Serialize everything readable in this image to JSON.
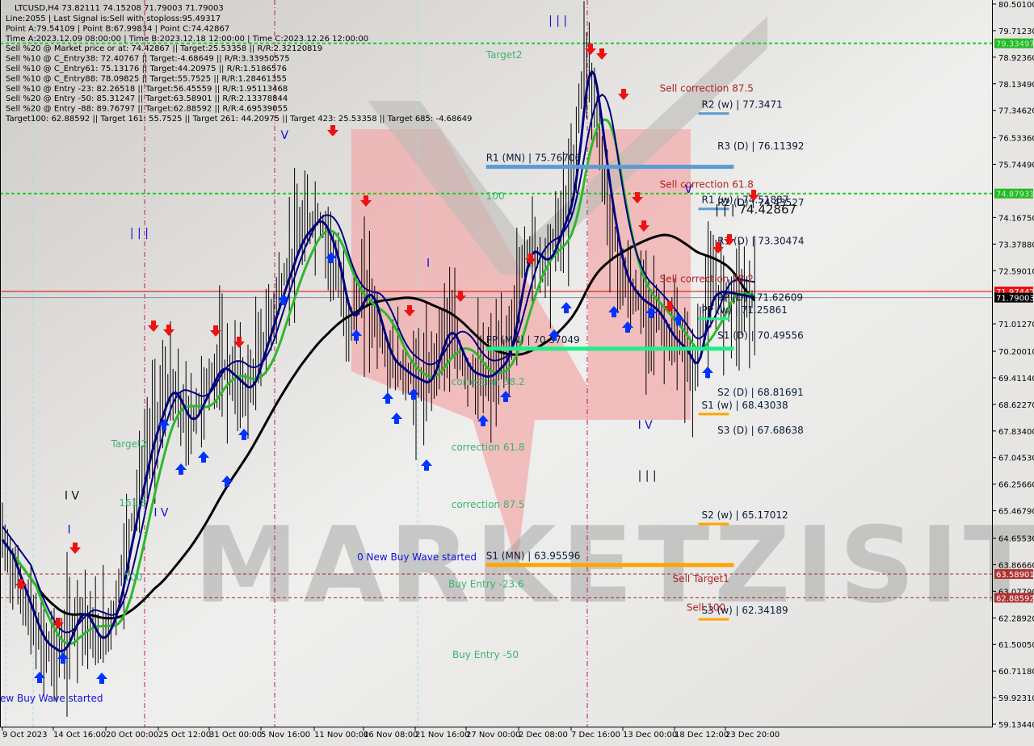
{
  "header": {
    "symbol_line": "LTCUSD,H4  73.82111 74.15208 71.79003 71.79003",
    "info_lines": [
      "Line:2055 | Last Signal is:Sell with stoploss:95.49317",
      "Point A:79.54109 | Point B:67.99834 | Point C:74.42867",
      "Time A:2023.12.09 08:00:00 | Time B:2023.12.18 12:00:00 | Time C:2023.12.26 12:00:00",
      "Sell %20 @ Market price or at: 74.42867 || Target:25.53358 || R/R:2.32120819",
      "Sell %10 @ C_Entry38: 72.40767 || Target:-4.68649 || R/R:3.33950575",
      "Sell %10 @ C_Entry61: 75.13176 || Target:44.20975 || R/R:1.5186576",
      "Sell %10 @ C_Entry88: 78.09825 || Target:55.7525 || R/R:1.28461355",
      "Sell %10 @ Entry -23: 82.26518 || Target:56.45559 || R/R:1.95113468",
      "Sell %20 @ Entry -50: 85.31247 || Target:63.58901 || R/R:2.13378844",
      "Sell %20 @ Entry -88: 89.76797 || Target:62.88592 || R/R:4.69539055",
      "Target100: 62.88592 || Target 161: 55.7525 || Target 261: 44.20975 || Target 423: 25.53358 || Target 685: -4.68649"
    ]
  },
  "colors": {
    "background": "#e6e5e3",
    "candle": "#000000",
    "ma_slow": "#000000",
    "ma_fast": "#000080",
    "ma_mid": "#2db82d",
    "green_level": "#22cc22",
    "red_level": "#a52a2a",
    "bid_line": "#dd0000",
    "pivot_blue": "#5b9bd5",
    "pivot_orange": "#ffa500",
    "pivot_green": "#22ee88",
    "watermark_pink": "#f0a0a0",
    "buy_arrow": "#0033ff",
    "sell_arrow": "#ee1111"
  },
  "chart_data": {
    "type": "candlestick",
    "title": "LTCUSD,H4",
    "ohlc_last": {
      "open": 73.82111,
      "high": 74.15208,
      "low": 71.79003,
      "close": 71.79003
    },
    "ylim": [
      59.1344,
      80.501
    ],
    "y_ticks": [
      "80.50100",
      "79.71230",
      "78.92360",
      "78.13490",
      "77.34620",
      "76.53360",
      "75.74490",
      "74.16750",
      "73.37880",
      "72.59010",
      "71.01270",
      "70.20010",
      "69.41140",
      "68.62270",
      "67.83400",
      "67.04530",
      "66.25660",
      "65.46790",
      "64.65530",
      "63.86660",
      "63.07790",
      "62.28920",
      "61.50050",
      "60.71180",
      "59.92310",
      "59.13440"
    ],
    "x_ticks": [
      "9 Oct 2023",
      "14 Oct 16:00",
      "20 Oct 00:00",
      "25 Oct 12:00",
      "31 Oct 00:00",
      "5 Nov 16:00",
      "11 Nov 00:00",
      "16 Nov 08:00",
      "21 Nov 16:00",
      "27 Nov 00:00",
      "2 Dec 08:00",
      "7 Dec 16:00",
      "13 Dec 00:00",
      "18 Dec 12:00",
      "23 Dec 20:00"
    ],
    "price_tags": [
      {
        "value": 79.33497,
        "label": "79.33497",
        "style": "green"
      },
      {
        "value": 74.87931,
        "label": "74.87931",
        "style": "green"
      },
      {
        "value": 71.97442,
        "label": "71.97442",
        "style": "red"
      },
      {
        "value": 71.79003,
        "label": "71.79003",
        "style": "black"
      },
      {
        "value": 63.58901,
        "label": "63.58901",
        "style": "darkred"
      },
      {
        "value": 62.88592,
        "label": "62.88592",
        "style": "darkred"
      }
    ],
    "horizontal_lines": [
      {
        "name": "target-level-top",
        "value": 79.33497,
        "style": "green-dashed"
      },
      {
        "name": "target-level-100",
        "value": 74.87931,
        "style": "green-dashed"
      },
      {
        "name": "bid-line",
        "value": 71.97442,
        "style": "red-solid"
      },
      {
        "name": "last-price-line",
        "value": 71.79003,
        "style": "grey-solid"
      },
      {
        "name": "sell-target1-line",
        "value": 63.58901,
        "style": "red-dashed"
      },
      {
        "name": "sell-100-line",
        "value": 62.88592,
        "style": "red-dashed"
      }
    ],
    "pivot_levels": [
      {
        "label": "R2 (w) | 77.3471",
        "value": 77.3471,
        "color": "blue",
        "start": 0.704,
        "end": 0.73
      },
      {
        "label": "R3 (D) | 76.11392",
        "value": 76.11392,
        "color": "blue",
        "start": 0.72,
        "end": 0.73
      },
      {
        "label": "R1 (MN) | 75.76706",
        "value": 75.76706,
        "color": "blue",
        "start": 0.49,
        "end": 0.73
      },
      {
        "label": "R1 (w) | 74.51887",
        "value": 74.51887,
        "color": "blue",
        "start": 0.704,
        "end": 0.73
      },
      {
        "label": "R2 (D) | 74.43527",
        "value": 74.43527,
        "color": "blue",
        "start": 0.72,
        "end": 0.73
      },
      {
        "label": "R1 (D) | 73.30474",
        "value": 73.30474,
        "color": "blue",
        "start": 0.72,
        "end": 0.73
      },
      {
        "label": "PP (D) | 71.62609",
        "value": 71.62609,
        "color": "green",
        "start": 0.72,
        "end": 0.73
      },
      {
        "label": "PP (w) | 71.25861",
        "value": 71.25861,
        "color": "green",
        "start": 0.704,
        "end": 0.73
      },
      {
        "label": "PP (MN) | 70.37049",
        "value": 70.37049,
        "color": "green",
        "start": 0.49,
        "end": 0.73
      },
      {
        "label": "S1 (D) | 70.49556",
        "value": 70.49556,
        "color": "orange",
        "start": 0.72,
        "end": 0.73
      },
      {
        "label": "S2 (D) | 68.81691",
        "value": 68.81691,
        "color": "orange",
        "start": 0.72,
        "end": 0.73
      },
      {
        "label": "S1 (w) | 68.43038",
        "value": 68.43038,
        "color": "orange",
        "start": 0.704,
        "end": 0.73
      },
      {
        "label": "S3 (D) | 67.68638",
        "value": 67.68638,
        "color": "orange",
        "start": 0.72,
        "end": 0.73
      },
      {
        "label": "S2 (w) | 65.17012",
        "value": 65.17012,
        "color": "orange",
        "start": 0.704,
        "end": 0.73
      },
      {
        "label": "S1 (MN) | 63.95596",
        "value": 63.95596,
        "color": "orange",
        "start": 0.49,
        "end": 0.73
      },
      {
        "label": "S3 (w) | 62.34189",
        "value": 62.34189,
        "color": "orange",
        "start": 0.704,
        "end": 0.73
      }
    ],
    "point_c_label": "| | | 74.42867",
    "annotations": [
      {
        "text": "Target2",
        "value": 78.9,
        "x": 0.49,
        "color": "green"
      },
      {
        "text": "Sell correction 87.5",
        "value": 77.9,
        "x": 0.665,
        "color": "darkred"
      },
      {
        "text": "100",
        "value": 74.7,
        "x": 0.49,
        "color": "green"
      },
      {
        "text": "Sell correction 61.8",
        "value": 75.05,
        "x": 0.665,
        "color": "darkred"
      },
      {
        "text": "Sell correction 38.2",
        "value": 72.25,
        "x": 0.665,
        "color": "darkred"
      },
      {
        "text": "correction 38.2",
        "value": 69.2,
        "x": 0.455,
        "color": "green"
      },
      {
        "text": "correction 61.8",
        "value": 67.25,
        "x": 0.455,
        "color": "green"
      },
      {
        "text": "correction 87.5",
        "value": 65.55,
        "x": 0.455,
        "color": "green"
      },
      {
        "text": "0 New Buy Wave started",
        "value": 64.0,
        "x": 0.36,
        "color": "blue"
      },
      {
        "text": "Buy Entry -23.6",
        "value": 63.2,
        "x": 0.452,
        "color": "green"
      },
      {
        "text": "Buy Entry -50",
        "value": 61.1,
        "x": 0.456,
        "color": "green"
      },
      {
        "text": "Sell Target1",
        "value": 63.35,
        "x": 0.678,
        "color": "darkred"
      },
      {
        "text": "Sell 100",
        "value": 62.5,
        "x": 0.692,
        "color": "darkred"
      },
      {
        "text": "Target2",
        "value": 67.35,
        "x": 0.112,
        "color": "green"
      },
      {
        "text": "161.8",
        "value": 65.6,
        "x": 0.12,
        "color": "green"
      },
      {
        "text": "100",
        "value": 63.4,
        "x": 0.125,
        "color": "green"
      },
      {
        "text": "ew Buy Wave started",
        "value": 59.8,
        "x": 0.0,
        "color": "blue"
      }
    ],
    "wave_labels": [
      {
        "text": "| | |",
        "value": 79.9,
        "x": 0.553,
        "color": "blue"
      },
      {
        "text": "| | |",
        "value": 73.6,
        "x": 0.131,
        "color": "blue"
      },
      {
        "text": "V",
        "value": 76.5,
        "x": 0.283,
        "color": "blue"
      },
      {
        "text": "I",
        "value": 72.7,
        "x": 0.43,
        "color": "blue"
      },
      {
        "text": "I V",
        "value": 65.3,
        "x": 0.155,
        "color": "blue"
      },
      {
        "text": "I V",
        "value": 65.8,
        "x": 0.065,
        "color": "black"
      },
      {
        "text": "I",
        "value": 64.8,
        "x": 0.068,
        "color": "blue"
      },
      {
        "text": "I V",
        "value": 67.9,
        "x": 0.643,
        "color": "blue"
      },
      {
        "text": "| | |",
        "value": 66.4,
        "x": 0.643,
        "color": "black"
      },
      {
        "text": "V",
        "value": 74.9,
        "x": 0.69,
        "color": "blue"
      }
    ],
    "watermark": "MARKETZISITE"
  }
}
